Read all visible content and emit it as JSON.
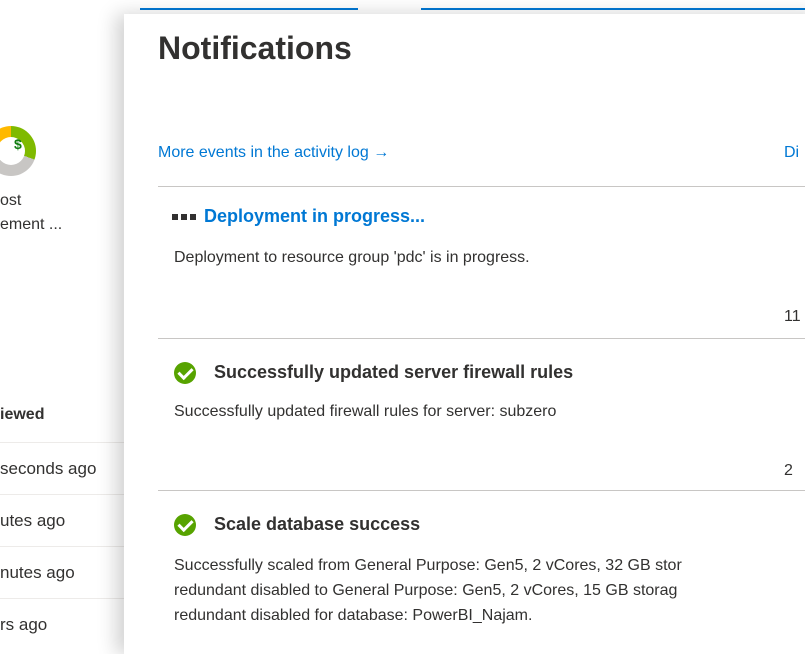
{
  "background": {
    "donut_label": "$",
    "tile_line1": "ost",
    "tile_line2": "ement ...",
    "viewed_header": "iewed",
    "recent": [
      "seconds ago",
      "utes ago",
      "nutes ago",
      "rs ago"
    ]
  },
  "panel": {
    "title": "Notifications",
    "activity_link": "More events in the activity log →",
    "dismiss_link": "Di"
  },
  "notifications": [
    {
      "title": "Deployment in progress...",
      "description": "Deployment to resource group 'pdc' is in progress.",
      "time": "11",
      "status": "in-progress"
    },
    {
      "title": "Successfully updated server firewall rules",
      "description": "Successfully updated firewall rules for server: subzero",
      "time": "2",
      "status": "success"
    },
    {
      "title": "Scale database success",
      "description_lines": [
        "Successfully scaled from General Purpose: Gen5, 2 vCores, 32 GB stor",
        "redundant disabled to General Purpose: Gen5, 2 vCores, 15 GB storag",
        "redundant disabled for database: PowerBI_Najam."
      ],
      "status": "success"
    }
  ],
  "colors": {
    "accent": "#0078d4",
    "success": "#57a300"
  }
}
